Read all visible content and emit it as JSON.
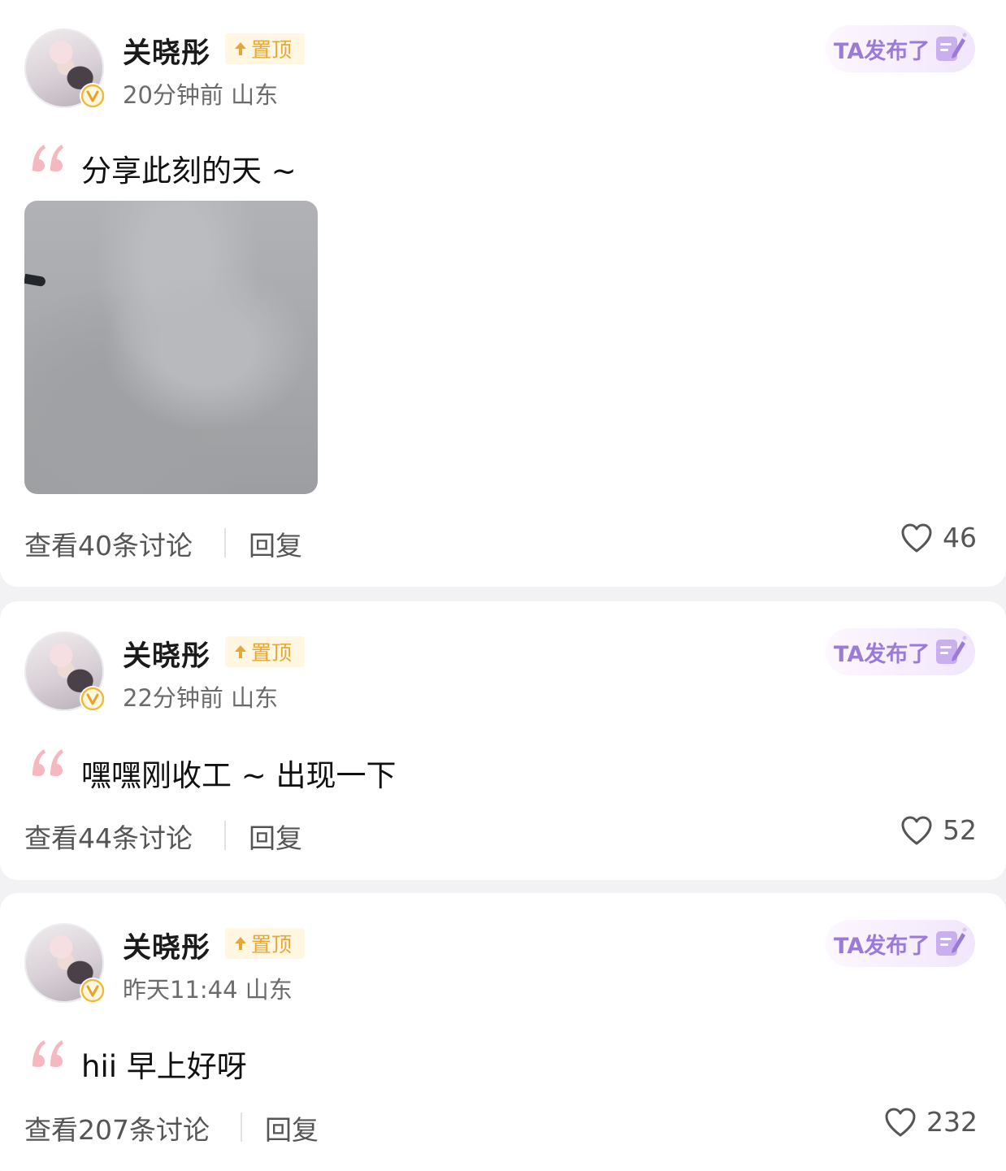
{
  "posts": [
    {
      "username": "关晓彤",
      "pinned_label": "置顶",
      "meta": "20分钟前 山东",
      "ta_button": "TA发布了",
      "text": "分享此刻的天 ~",
      "has_image": true,
      "discuss_label": "查看40条讨论",
      "reply_label": "回复",
      "like_count": "46"
    },
    {
      "username": "关晓彤",
      "pinned_label": "置顶",
      "meta": "22分钟前 山东",
      "ta_button": "TA发布了",
      "text": "嘿嘿刚收工 ~ 出现一下",
      "has_image": false,
      "discuss_label": "查看44条讨论",
      "reply_label": "回复",
      "like_count": "52"
    },
    {
      "username": "关晓彤",
      "pinned_label": "置顶",
      "meta": "昨天11:44 山东",
      "ta_button": "TA发布了",
      "text": "hii 早上好呀",
      "has_image": false,
      "discuss_label": "查看207条讨论",
      "reply_label": "回复",
      "like_count": "232"
    }
  ],
  "icons": {
    "pinned": "arrow-up-icon",
    "verified": "v-badge-icon",
    "ta": "pen-note-icon",
    "quote": "quote-icon",
    "like": "heart-icon"
  },
  "colors": {
    "pinned_text": "#e6a736",
    "pinned_bg": "#fff7e2",
    "ta_text": "#9b7ad8",
    "quote": "#f6b8c0",
    "verified": "#f0b93a"
  }
}
